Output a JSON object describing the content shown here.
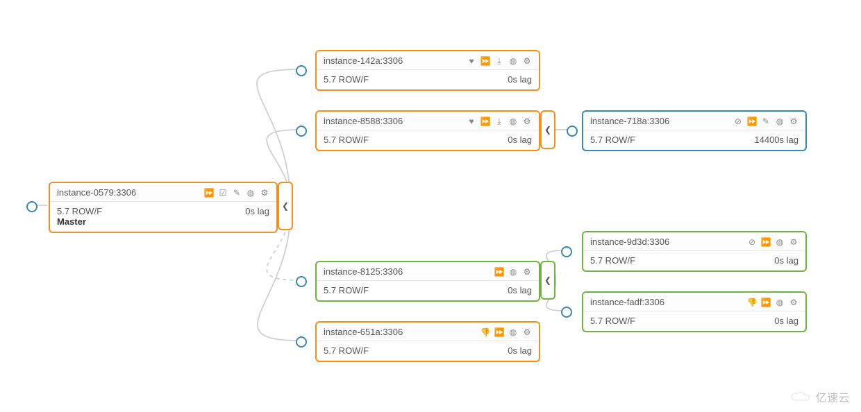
{
  "colors": {
    "orange": "#f58d1f",
    "green": "#6cb33f",
    "blue": "#3a87ad",
    "port": "#3a87ad"
  },
  "icon_glyphs": {
    "heart": "♥",
    "fast-forward": "⏩",
    "download": "⤓",
    "globe": "●",
    "gear": "⚙",
    "checkbox": "☑",
    "pencil": "✎",
    "stop": "⃠",
    "thumbs-down": "👎",
    "chevron-left": "❮"
  },
  "nodes": {
    "master": {
      "title": "instance-0579:3306",
      "version": "5.7 ROW/F",
      "role": "Master",
      "lag": "0s lag",
      "color": "orange",
      "icons": [
        "fast-forward",
        "checkbox",
        "pencil",
        "globe",
        "gear"
      ],
      "collapse": true
    },
    "n142a": {
      "title": "instance-142a:3306",
      "version": "5.7 ROW/F",
      "lag": "0s lag",
      "color": "orange",
      "icons": [
        "heart",
        "fast-forward",
        "download",
        "globe",
        "gear"
      ]
    },
    "n8588": {
      "title": "instance-8588:3306",
      "version": "5.7 ROW/F",
      "lag": "0s lag",
      "color": "orange",
      "icons": [
        "heart",
        "fast-forward",
        "download",
        "globe",
        "gear"
      ],
      "collapse": true
    },
    "n718a": {
      "title": "instance-718a:3306",
      "version": "5.7 ROW/F",
      "lag": "14400s lag",
      "color": "blue",
      "icons": [
        "stop",
        "fast-forward",
        "pencil",
        "globe",
        "gear"
      ]
    },
    "n8125": {
      "title": "instance-8125:3306",
      "version": "5.7 ROW/F",
      "lag": "0s lag",
      "color": "green",
      "icons": [
        "fast-forward",
        "globe",
        "gear"
      ],
      "collapse": true
    },
    "n9d3d": {
      "title": "instance-9d3d:3306",
      "version": "5.7 ROW/F",
      "lag": "0s lag",
      "color": "green",
      "icons": [
        "stop",
        "fast-forward",
        "globe",
        "gear"
      ]
    },
    "nfadf": {
      "title": "instance-fadf:3306",
      "version": "5.7 ROW/F",
      "lag": "0s lag",
      "color": "green",
      "icons": [
        "thumbs-down",
        "fast-forward",
        "globe",
        "gear"
      ]
    },
    "n651a": {
      "title": "instance-651a:3306",
      "version": "5.7 ROW/F",
      "lag": "0s lag",
      "color": "orange",
      "icons": [
        "thumbs-down",
        "fast-forward",
        "globe",
        "gear"
      ]
    }
  },
  "watermark": "亿速云"
}
